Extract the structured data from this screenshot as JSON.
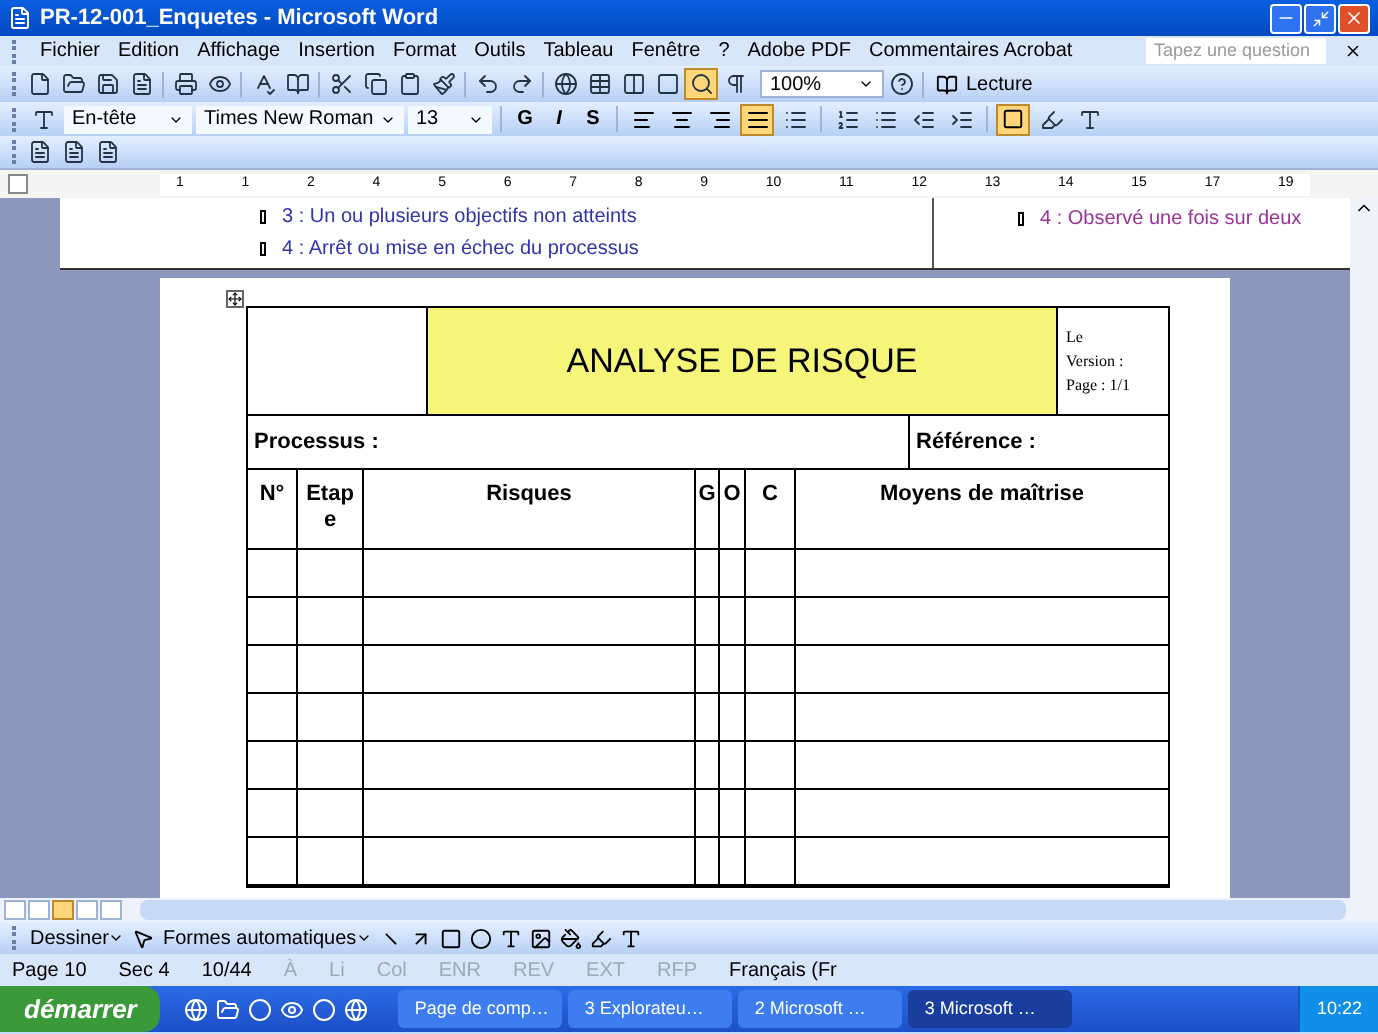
{
  "window": {
    "title": "PR-12-001_Enquetes - Microsoft Word"
  },
  "menu": {
    "items": [
      "Fichier",
      "Edition",
      "Affichage",
      "Insertion",
      "Format",
      "Outils",
      "Tableau",
      "Fenêtre",
      "?",
      "Adobe PDF",
      "Commentaires Acrobat"
    ],
    "search": {
      "placeholder": "Tapez une question"
    }
  },
  "standard_toolbar": {
    "zoom": "100%",
    "reading_button": "Lecture"
  },
  "format_toolbar": {
    "style": "En-tête",
    "font": "Times New Roman",
    "size": "13",
    "bold": "G",
    "italic": "I",
    "underline": "S",
    "alignment": [
      {
        "selected": false
      },
      {
        "selected": false
      },
      {
        "selected": false
      },
      {
        "selected": true
      }
    ],
    "borders_selected": true
  },
  "ruler": {
    "labels": [
      "1",
      "1",
      "2",
      "4",
      "5",
      "6",
      "7",
      "8",
      "9",
      "10",
      "11",
      "12",
      "13",
      "14",
      "15",
      "17",
      "19"
    ]
  },
  "document": {
    "left_items": [
      {
        "text": "3 : Un ou plusieurs objectifs non atteints",
        "color": "#3333aa"
      },
      {
        "text": "4 : Arrêt ou mise en échec du processus",
        "color": "#3333aa"
      }
    ],
    "right_items": [
      {
        "text": "4 : Observé une fois sur deux",
        "color": "#993399"
      }
    ],
    "form": {
      "title": "ANALYSE DE RISQUE",
      "meta": [
        "Le",
        "Version :",
        "Page : 1/1"
      ],
      "process_label": "Processus :",
      "reference_label": "Référence :",
      "columns": [
        "N°",
        "Etap e",
        "Risques",
        "G",
        "O",
        "C",
        "Moyens de maîtrise"
      ]
    }
  },
  "view_buttons": [
    {
      "selected": false
    },
    {
      "selected": false
    },
    {
      "selected": true
    },
    {
      "selected": false
    },
    {
      "selected": false
    }
  ],
  "drawing_toolbar": {
    "draw_menu": "Dessiner",
    "autoshapes_menu": "Formes automatiques"
  },
  "status_bar": [
    {
      "text": "Page 10",
      "disabled": false
    },
    {
      "text": "Sec 4",
      "disabled": false
    },
    {
      "text": "10/44",
      "disabled": false
    },
    {
      "text": "À",
      "disabled": true
    },
    {
      "text": "Li",
      "disabled": true
    },
    {
      "text": "Col",
      "disabled": true
    },
    {
      "text": "ENR",
      "disabled": true
    },
    {
      "text": "REV",
      "disabled": true
    },
    {
      "text": "EXT",
      "disabled": true
    },
    {
      "text": "RFP",
      "disabled": true
    },
    {
      "text": "Français (Fr",
      "disabled": false
    }
  ],
  "taskbar": {
    "start": "démarrer",
    "tasks": [
      {
        "label": "Page de comp…",
        "selected": false
      },
      {
        "label": "3 Explorateu…",
        "selected": false
      },
      {
        "label": "2 Microsoft …",
        "selected": false
      },
      {
        "label": "3 Microsoft …",
        "selected": true
      }
    ],
    "clock": "10:22"
  }
}
